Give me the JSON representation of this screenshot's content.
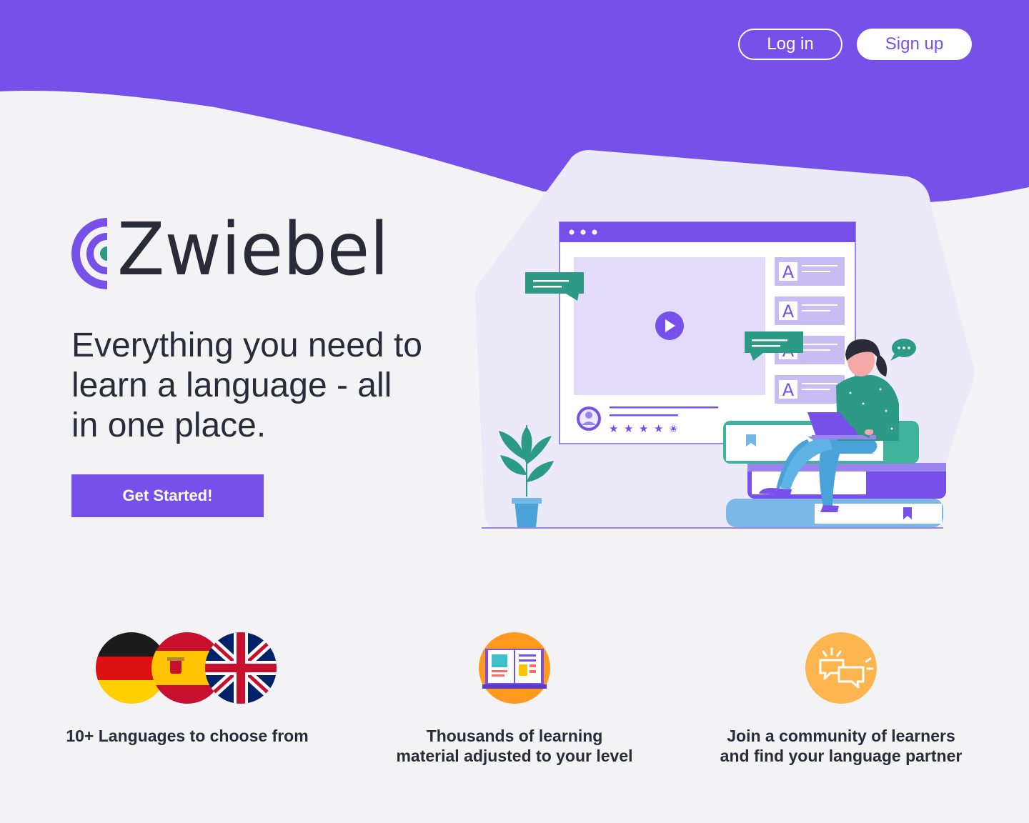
{
  "nav": {
    "login_label": "Log in",
    "signup_label": "Sign up"
  },
  "brand": {
    "name": "Zwiebel"
  },
  "hero": {
    "tagline_lines": [
      "Everything you need to",
      "learn a language - all",
      "in one place."
    ],
    "cta_label": "Get Started!"
  },
  "features": [
    {
      "icon": "flags-icon",
      "text": "10+ Languages to choose from"
    },
    {
      "icon": "open-book-icon",
      "text": "Thousands of learning material adjusted to your level"
    },
    {
      "icon": "chat-bubbles-icon",
      "text": "Join a community of learners and find your language partner"
    }
  ],
  "illustration": {
    "letter_tiles": [
      "A",
      "A",
      "A",
      "A"
    ],
    "rating_stars": 4.5
  },
  "colors": {
    "primary": "#7650e8",
    "background": "#f3f3f5",
    "text": "#2a2b38",
    "accent_teal": "#2c9a84",
    "accent_orange": "#fcb54f"
  }
}
